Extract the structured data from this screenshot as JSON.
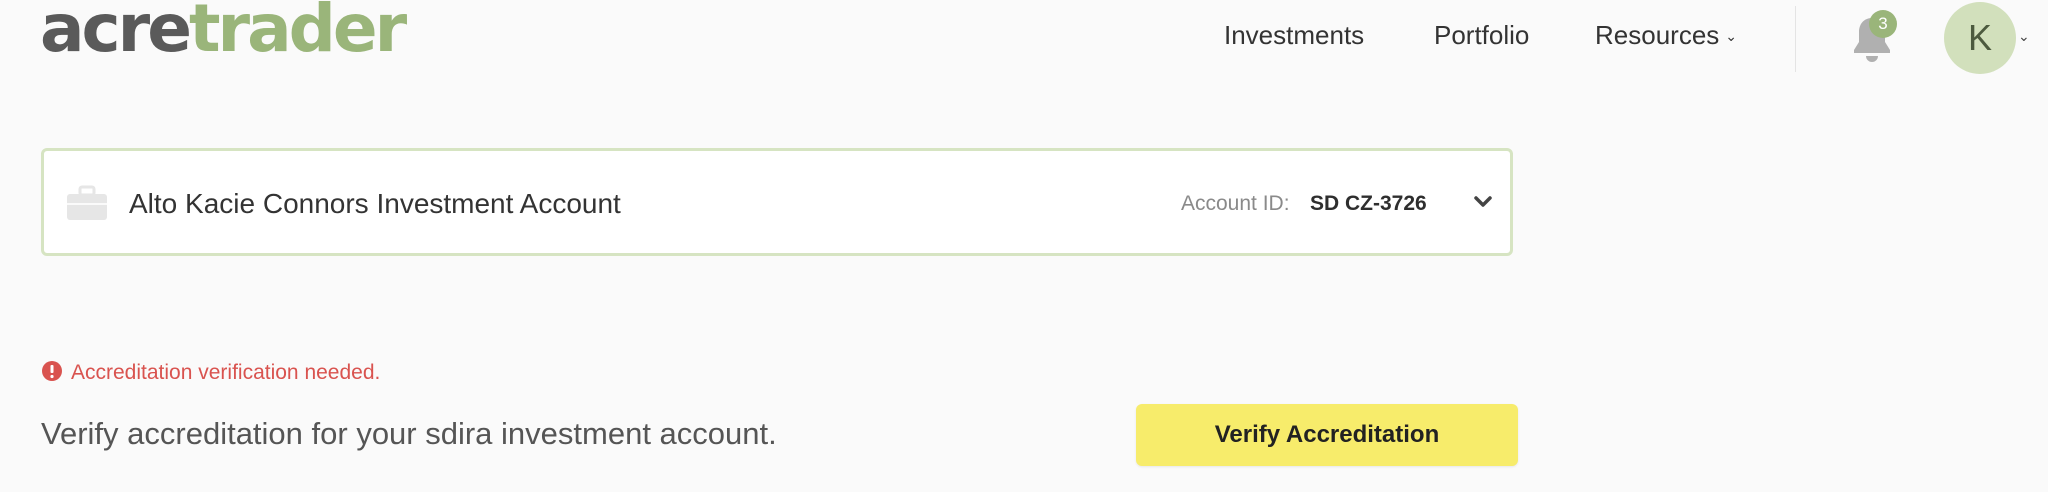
{
  "header": {
    "logo": {
      "part1": "acre",
      "part2": "trader"
    },
    "nav": [
      {
        "label": "Investments"
      },
      {
        "label": "Portfolio"
      },
      {
        "label": "Resources",
        "has_dropdown": true
      }
    ],
    "notifications": {
      "icon": "bell-icon",
      "count": "3"
    },
    "user": {
      "initial": "K"
    }
  },
  "account_card": {
    "icon": "briefcase-icon",
    "title": "Alto Kacie Connors Investment Account",
    "account_id_label": "Account ID:",
    "account_id_value": "SD CZ-3726"
  },
  "alert": {
    "icon": "exclamation-circle-icon",
    "message": "Accreditation verification needed."
  },
  "verify": {
    "text": "Verify accreditation for your sdira investment account.",
    "button_label": "Verify Accreditation"
  },
  "colors": {
    "brand_gray": "#5a5a5a",
    "brand_green": "#9ab57a",
    "alert_red": "#d9534f",
    "button_yellow": "#f7ec6b",
    "card_border": "#d6e4c2"
  }
}
